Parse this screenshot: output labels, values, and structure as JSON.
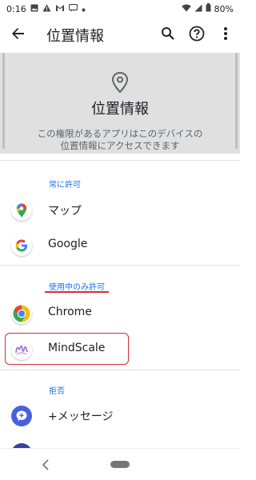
{
  "status_bar": {
    "time": "0:16",
    "battery": "80%",
    "icons": [
      "image-icon",
      "warning-icon",
      "gmail-icon",
      "message-icon",
      "dot-icon",
      "wifi-icon",
      "signal-icon",
      "battery-icon"
    ]
  },
  "app_bar": {
    "title": "位置情報",
    "icons": [
      "back-arrow-icon",
      "search-icon",
      "help-icon",
      "more-vert-icon"
    ]
  },
  "hero": {
    "title": "位置情報",
    "icon": "location-pin-icon"
  },
  "subtitle": {
    "line1": "この権限があるアプリはこのデバイスの",
    "line2": "位置情報にアクセスできます"
  },
  "sections": {
    "always": {
      "label": "常に許可"
    },
    "while_using": {
      "label": "使用中のみ許可"
    },
    "denied": {
      "label": "拒否"
    }
  },
  "apps": {
    "maps": {
      "label": "マップ",
      "icon": "google-maps-icon"
    },
    "google": {
      "label": "Google",
      "icon": "google-icon"
    },
    "chrome": {
      "label": "Chrome",
      "icon": "chrome-icon"
    },
    "mindscale": {
      "label": "MindScale",
      "icon": "mindscale-icon"
    },
    "messages": {
      "label": "+メッセージ",
      "icon": "plus-message-icon"
    }
  },
  "colors": {
    "accent": "#1a73e8",
    "highlight": "#e0283c",
    "hero_bg": "#e0e0e0"
  }
}
